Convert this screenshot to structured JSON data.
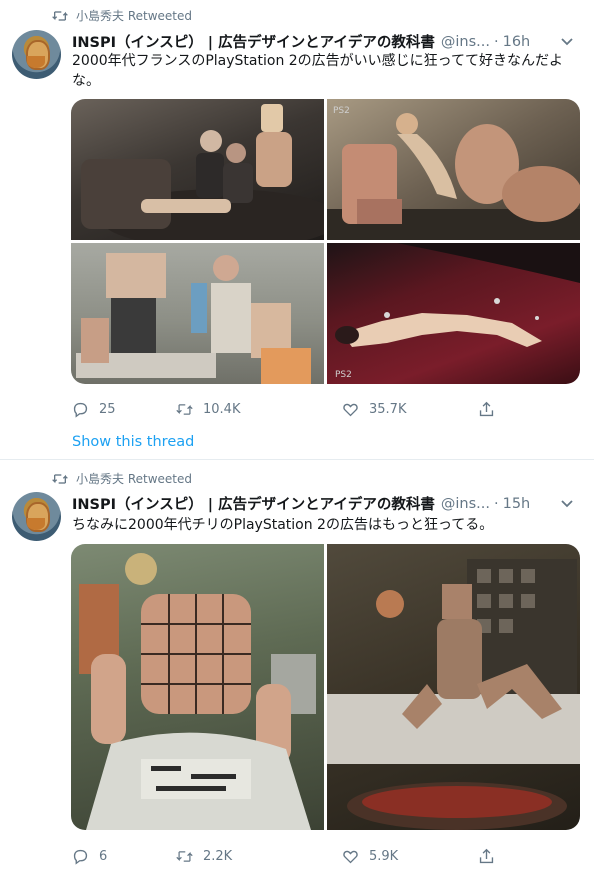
{
  "tweets": [
    {
      "retweeted_by": "小島秀夫 Retweeted",
      "author_name": "INSPI（インスピ） | 広告デザインとアイデアの教科書",
      "author_handle": "@ins...",
      "separator": "·",
      "time": "16h",
      "text": "2000年代フランスのPlayStation 2の広告がいい感じに狂ってて好きなんだよな。",
      "replies": "25",
      "retweets": "10.4K",
      "likes": "35.7K",
      "show_thread": "Show this thread"
    },
    {
      "retweeted_by": "小島秀夫 Retweeted",
      "author_name": "INSPI（インスピ） | 広告デザインとアイデアの教科書",
      "author_handle": "@ins...",
      "separator": "·",
      "time": "15h",
      "text": "ちなみに2000年代チリのPlayStation 2の広告はもっと狂ってる。",
      "replies": "6",
      "retweets": "2.2K",
      "likes": "5.9K"
    }
  ],
  "media_labels": {
    "photo_logo": "PS2"
  },
  "colors": {
    "accent": "#1da1f2",
    "secondary_text": "#657786",
    "divider": "#e6ecf0"
  },
  "icons": [
    "retweet-icon",
    "caret-down-icon",
    "reply-icon",
    "like-icon",
    "share-icon"
  ]
}
